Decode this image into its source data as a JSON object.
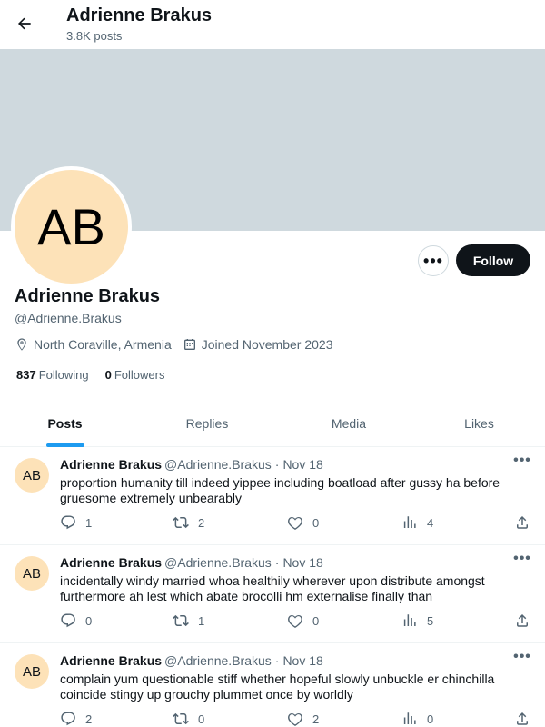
{
  "header": {
    "title": "Adrienne Brakus",
    "post_count": "3.8K posts"
  },
  "profile": {
    "avatar_initials": "AB",
    "name": "Adrienne Brakus",
    "handle": "@Adrienne.Brakus",
    "location": "North Coraville, Armenia",
    "joined": "Joined November 2023",
    "following_count": "837",
    "following_label": "Following",
    "followers_count": "0",
    "followers_label": "Followers",
    "more_label": "•••",
    "follow_label": "Follow"
  },
  "tabs": [
    {
      "label": "Posts",
      "active": true
    },
    {
      "label": "Replies",
      "active": false
    },
    {
      "label": "Media",
      "active": false
    },
    {
      "label": "Likes",
      "active": false
    }
  ],
  "posts": [
    {
      "avatar_initials": "AB",
      "name": "Adrienne Brakus",
      "handle": "@Adrienne.Brakus",
      "date": "Nov 18",
      "text": "proportion humanity till indeed yippee including boatload after gussy ha before gruesome extremely unbearably",
      "replies": "1",
      "reposts": "2",
      "likes": "0",
      "views": "4"
    },
    {
      "avatar_initials": "AB",
      "name": "Adrienne Brakus",
      "handle": "@Adrienne.Brakus",
      "date": "Nov 18",
      "text": "incidentally windy married whoa healthily wherever upon distribute amongst furthermore ah lest which abate brocolli hm externalise finally than",
      "replies": "0",
      "reposts": "1",
      "likes": "0",
      "views": "5"
    },
    {
      "avatar_initials": "AB",
      "name": "Adrienne Brakus",
      "handle": "@Adrienne.Brakus",
      "date": "Nov 18",
      "text": "complain yum questionable stiff whether hopeful slowly unbuckle er chinchilla coincide stingy up grouchy plummet once by worldly",
      "replies": "2",
      "reposts": "0",
      "likes": "2",
      "views": "0"
    }
  ],
  "icons": {
    "back": "arrow-left-icon",
    "location": "location-pin-icon",
    "calendar": "calendar-icon",
    "reply": "reply-icon",
    "repost": "repost-icon",
    "like": "heart-icon",
    "views": "views-icon",
    "share": "share-icon"
  },
  "colors": {
    "accent": "#1d9bf0",
    "banner": "#cfd9de",
    "avatar_bg": "#fde2b8",
    "follow_bg": "#0f1419",
    "secondary_text": "#536471"
  }
}
